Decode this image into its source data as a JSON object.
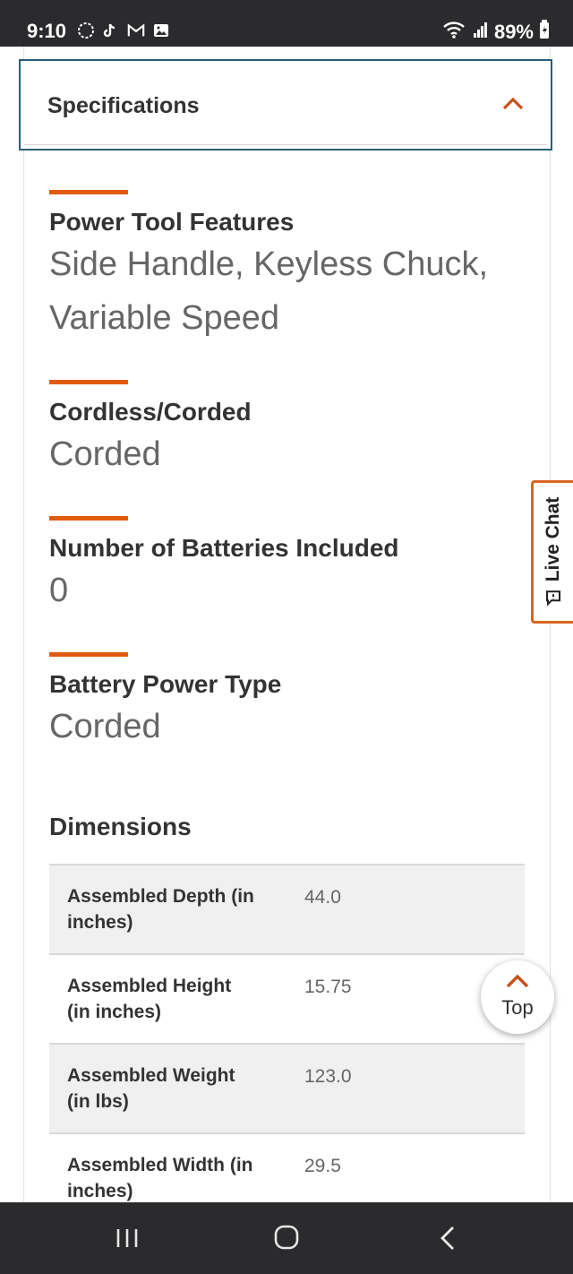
{
  "status_bar": {
    "time": "9:10",
    "battery": "89%"
  },
  "specifications": {
    "title": "Specifications"
  },
  "features": [
    {
      "label": "Power Tool Features",
      "value_lines": [
        "Side Handle, Keyless Chuck,",
        "Variable Speed"
      ]
    },
    {
      "label": "Cordless/Corded",
      "value_lines": [
        "Corded"
      ]
    },
    {
      "label": "Number of Batteries Included",
      "value_lines": [
        "0"
      ]
    },
    {
      "label": "Battery Power Type",
      "value_lines": [
        "Corded"
      ]
    }
  ],
  "dimensions": {
    "title": "Dimensions",
    "rows": [
      {
        "name_lines": [
          "Assembled Depth (in",
          "inches)"
        ],
        "value": "44.0"
      },
      {
        "name_lines": [
          "Assembled Height",
          "(in inches)"
        ],
        "value": "15.75"
      },
      {
        "name_lines": [
          "Assembled Weight",
          "(in lbs)"
        ],
        "value": "123.0"
      },
      {
        "name_lines": [
          "Assembled Width (in",
          "inches)"
        ],
        "value": "29.5"
      }
    ]
  },
  "live_chat": {
    "label": "Live Chat"
  },
  "top_button": {
    "label": "Top"
  },
  "colors": {
    "accent": "#e05a10",
    "header_border": "#2a5f78",
    "chat_border": "#d9661f"
  }
}
